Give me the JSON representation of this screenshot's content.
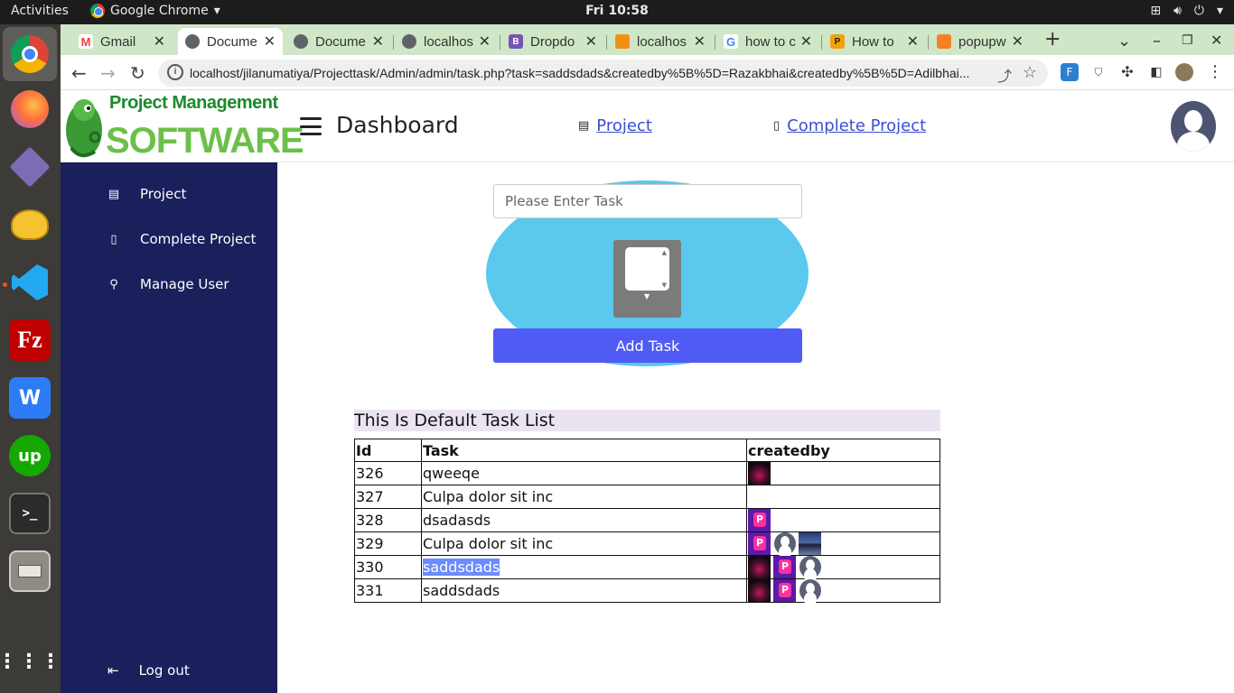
{
  "system": {
    "activities": "Activities",
    "app_name": "Google Chrome",
    "clock": "Fri 10:58"
  },
  "dock": {
    "items": [
      "chrome-icon",
      "firefox-icon",
      "package-icon",
      "teapot-icon",
      "vscode-icon",
      "filezilla-icon",
      "wps-icon",
      "upwork-icon",
      "terminal-icon",
      "files-icon",
      "apps-grid-icon"
    ]
  },
  "browser": {
    "tabs": [
      {
        "label": "Gmail",
        "color": "#ea4335"
      },
      {
        "label": "Docume",
        "color": "#5f6368"
      },
      {
        "label": "Docume",
        "color": "#5f6368"
      },
      {
        "label": "localhos",
        "color": "#5f6368"
      },
      {
        "label": "Dropdo",
        "color": "#7952b3"
      },
      {
        "label": "localhos",
        "color": "#f29111"
      },
      {
        "label": "how to c",
        "color": "#4285f4"
      },
      {
        "label": "How to",
        "color": "#f0a30a"
      },
      {
        "label": "popupw",
        "color": "#f48024"
      }
    ],
    "url": "localhost/jilanumatiya/Projecttask/Admin/admin/task.php?task=saddsdads&createdby%5B%5D=Razakbhai&createdby%5B%5D=Adilbhai..."
  },
  "header": {
    "logo_line1": "Project Management",
    "logo_line2": "SOFTWARE",
    "title": "Dashboard",
    "link_project": "Project",
    "link_complete": "Complete Project"
  },
  "sidebar": {
    "items": [
      {
        "label": "Project",
        "icon": "archive-icon"
      },
      {
        "label": "Complete Project",
        "icon": "book-icon"
      },
      {
        "label": "Manage User",
        "icon": "user-icon"
      }
    ],
    "logout": "Log out"
  },
  "form": {
    "placeholder": "Please Enter Task",
    "add_button": "Add Task"
  },
  "task_list": {
    "title": "This Is Default Task List",
    "columns": [
      "Id",
      "Task",
      "createdby"
    ],
    "rows": [
      {
        "id": "326",
        "task": "qweeqe",
        "creators": [
          "dark"
        ]
      },
      {
        "id": "327",
        "task": "Culpa dolor sit inc",
        "creators": []
      },
      {
        "id": "328",
        "task": "dsadasds",
        "creators": [
          "purple"
        ]
      },
      {
        "id": "329",
        "task": "Culpa dolor sit inc",
        "creators": [
          "purple",
          "user",
          "night"
        ]
      },
      {
        "id": "330",
        "task": "saddsdads",
        "creators": [
          "dark",
          "purple",
          "user"
        ],
        "selected": true
      },
      {
        "id": "331",
        "task": "saddsdads",
        "creators": [
          "dark",
          "purple",
          "user"
        ]
      }
    ]
  }
}
